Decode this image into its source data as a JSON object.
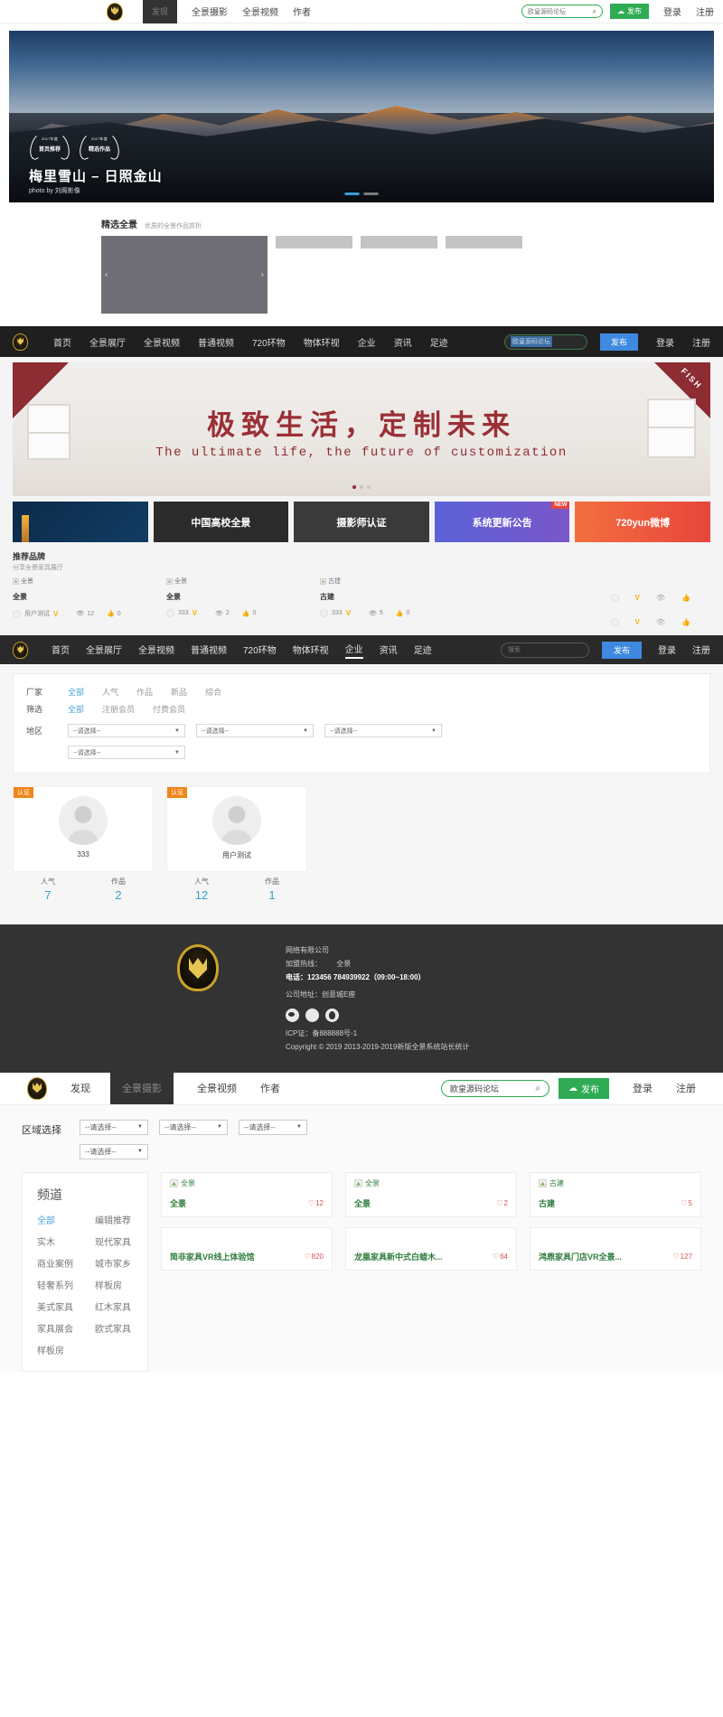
{
  "section1": {
    "nav": {
      "active_tab": "发现",
      "items": [
        "全景摄影",
        "全景视频",
        "作者"
      ]
    },
    "search": {
      "value": "欧皇源码论坛",
      "icon": "search-icon"
    },
    "publish": "发布",
    "login": "登录",
    "register": "注册",
    "hero": {
      "award1_top": "2017年度",
      "award1_bottom": "首页推荐",
      "award2_top": "2017年度",
      "award2_bottom": "精选作品",
      "title": "梅里雪山 – 日照金山",
      "subtitle": "photo by 刘阁影像"
    },
    "selected": {
      "title": "精选全景",
      "desc": "优质的全景作品赏析"
    }
  },
  "section2": {
    "nav": [
      "首页",
      "全景展厅",
      "全景视频",
      "普通视频",
      "720环物",
      "物体环视",
      "企业",
      "资讯",
      "足迹"
    ],
    "search_value": "欧皇源码论坛",
    "publish": "发布",
    "login": "登录",
    "register": "注册",
    "banner": {
      "headline": "极致生活，定制未来",
      "sub": "The ultimate life, the future of customization",
      "corner_text": "FISH"
    },
    "tiles": [
      {
        "label": "",
        "corner": ""
      },
      {
        "label": "中国高校全景",
        "corner": ""
      },
      {
        "label": "摄影师认证",
        "corner": ""
      },
      {
        "label": "系统更新公告",
        "corner": "NEW"
      },
      {
        "label": "720yun微博",
        "corner": ""
      }
    ],
    "brand": {
      "title": "推荐品牌",
      "desc": "分享全景家具展厅"
    },
    "cards": [
      {
        "thumb_alt": "全景",
        "title": "全景",
        "author": "用户测试",
        "views": "12",
        "likes": "0"
      },
      {
        "thumb_alt": "全景",
        "title": "全景",
        "author": "333",
        "views": "2",
        "likes": "0"
      },
      {
        "thumb_alt": "古建",
        "title": "古建",
        "author": "333",
        "views": "5",
        "likes": "0"
      }
    ]
  },
  "section3": {
    "nav": [
      "首页",
      "全景展厅",
      "全景视频",
      "普通视频",
      "720环物",
      "物体环视",
      "企业",
      "资讯",
      "足迹"
    ],
    "active": "企业",
    "search_placeholder": "搜索",
    "publish": "发布",
    "login": "登录",
    "register": "注册",
    "filters": {
      "row1_label": "厂家",
      "row1_options": [
        "全部",
        "人气",
        "作品",
        "新品",
        "综合"
      ],
      "row2_label": "筛选",
      "row2_options": [
        "全部",
        "注册会员",
        "付费会员"
      ],
      "row3_label": "地区",
      "select_placeholder": "--请选择--"
    },
    "user_cards": [
      {
        "badge": "认证",
        "name": "333",
        "stat1_label": "人气",
        "stat1_value": "7",
        "stat2_label": "作品",
        "stat2_value": "2"
      },
      {
        "badge": "认证",
        "name": "用户测试",
        "stat1_label": "人气",
        "stat1_value": "12",
        "stat2_label": "作品",
        "stat2_value": "1"
      }
    ]
  },
  "footer": {
    "company": "网络有限公司",
    "hotline_label": "加盟热线：",
    "hotline_value": "全景",
    "phone": "电话：123456 784939922（09:00~18:00）",
    "address": "公司地址：创意城E座",
    "icp": "ICP证：备888888号-1",
    "copyright": "Copyright © 2019 2013-2019-2019新版全景系统站长统计",
    "socials": [
      "weibo-icon",
      "wechat-icon",
      "qq-icon"
    ]
  },
  "section4": {
    "nav": {
      "items": [
        "发现",
        "全景摄影",
        "全景视频",
        "作者"
      ],
      "active": "全景摄影"
    },
    "search": {
      "value": "欧皇源码论坛"
    },
    "publish": "发布",
    "login": "登录",
    "register": "注册",
    "region_label": "区域选择",
    "region_placeholder": "--请选择--",
    "channel": {
      "title": "频道",
      "items": [
        {
          "label": "全部",
          "active": true
        },
        {
          "label": "编辑推荐",
          "active": false
        },
        {
          "label": "实木",
          "active": false
        },
        {
          "label": "现代家具",
          "active": false
        },
        {
          "label": "商业案例",
          "active": false
        },
        {
          "label": "城市家乡",
          "active": false
        },
        {
          "label": "轻奢系列",
          "active": false
        },
        {
          "label": "样板房",
          "active": false
        },
        {
          "label": "美式家具",
          "active": false
        },
        {
          "label": "红木家具",
          "active": false
        },
        {
          "label": "家具展会",
          "active": false
        },
        {
          "label": "欧式家具",
          "active": false
        },
        {
          "label": "样板房",
          "active": false
        }
      ]
    },
    "works": [
      {
        "thumb_alt": "全景",
        "title": "全景",
        "likes": "12",
        "blank": false
      },
      {
        "thumb_alt": "全景",
        "title": "全景",
        "likes": "2",
        "blank": false
      },
      {
        "thumb_alt": "古建",
        "title": "古建",
        "likes": "5",
        "blank": false
      },
      {
        "thumb_alt": "",
        "title": "简非家具VR线上体验馆",
        "likes": "820",
        "blank": true
      },
      {
        "thumb_alt": "",
        "title": "龙凰家具新中式白蜡木...",
        "likes": "64",
        "blank": true
      },
      {
        "thumb_alt": "",
        "title": "鸿鼎家具门店VR全景...",
        "likes": "127",
        "blank": true
      }
    ]
  }
}
